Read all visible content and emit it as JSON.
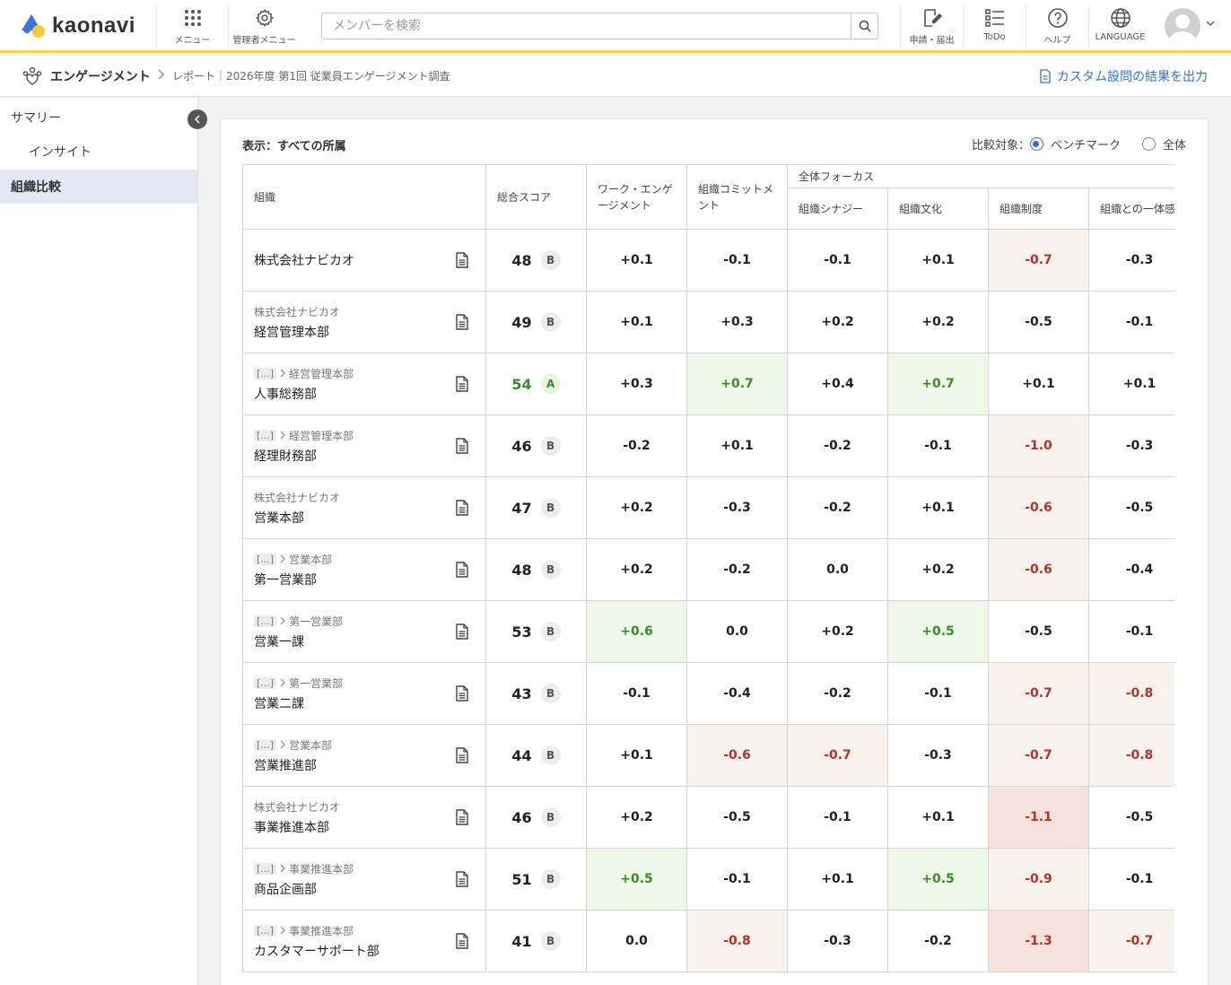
{
  "brand": {
    "logo_text": "kaonavi"
  },
  "topnav": {
    "menu_label": "メニュー",
    "admin_label": "管理者メニュー",
    "request_label": "申請・届出",
    "todo_label": "ToDo",
    "help_label": "ヘルプ",
    "language_label": "LANGUAGE"
  },
  "search": {
    "placeholder": "メンバーを検索"
  },
  "subheader": {
    "title": "エンゲージメント",
    "path": "レポート｜2026年度 第1回 従業員エンゲージメント調査",
    "export_label": "カスタム設問の結果を出力"
  },
  "sidebar": {
    "items": [
      {
        "label": "サマリー"
      },
      {
        "label": "インサイト"
      },
      {
        "label": "組織比較"
      }
    ]
  },
  "panel": {
    "display_label": "表示：すべての所属",
    "compare_label": "比較対象：",
    "compare_options": [
      "ベンチマーク",
      "全体"
    ],
    "compare_selected": "ベンチマーク"
  },
  "table": {
    "headers": {
      "org": "組織",
      "total": "総合スコア",
      "work": "ワーク・エンゲージメント",
      "commit": "組織コミットメント",
      "focus_group": "全体フォーカス",
      "focus": [
        "組織シナジー",
        "組織文化",
        "組織制度",
        "組織との一体感"
      ]
    },
    "rows": [
      {
        "parent": "",
        "name": "株式会社ナビカオ",
        "score": 48,
        "grade": "B",
        "values": [
          "+0.1",
          "-0.1",
          "-0.1",
          "+0.1",
          "-0.7",
          "-0.3"
        ],
        "tones": [
          "",
          "",
          "",
          "",
          "neg1",
          ""
        ]
      },
      {
        "parent": "株式会社ナビカオ",
        "name": "経営管理本部",
        "score": 49,
        "grade": "B",
        "values": [
          "+0.1",
          "+0.3",
          "+0.2",
          "+0.2",
          "-0.5",
          "-0.1"
        ],
        "tones": [
          "",
          "",
          "",
          "",
          "",
          ""
        ]
      },
      {
        "parent": "経営管理本部",
        "ellipsis": "[...]",
        "name": "人事総務部",
        "score": 54,
        "grade": "A",
        "values": [
          "+0.3",
          "+0.7",
          "+0.4",
          "+0.7",
          "+0.1",
          "+0.1"
        ],
        "tones": [
          "",
          "pos",
          "",
          "pos",
          "",
          ""
        ]
      },
      {
        "parent": "経営管理本部",
        "ellipsis": "[...]",
        "name": "経理財務部",
        "score": 46,
        "grade": "B",
        "values": [
          "-0.2",
          "+0.1",
          "-0.2",
          "-0.1",
          "-1.0",
          "-0.3"
        ],
        "tones": [
          "",
          "",
          "",
          "",
          "neg1",
          ""
        ]
      },
      {
        "parent": "株式会社ナビカオ",
        "name": "営業本部",
        "score": 47,
        "grade": "B",
        "values": [
          "+0.2",
          "-0.3",
          "-0.2",
          "+0.1",
          "-0.6",
          "-0.5"
        ],
        "tones": [
          "",
          "",
          "",
          "",
          "neg1",
          ""
        ]
      },
      {
        "parent": "営業本部",
        "ellipsis": "[...]",
        "name": "第一営業部",
        "score": 48,
        "grade": "B",
        "values": [
          "+0.2",
          "-0.2",
          "0.0",
          "+0.2",
          "-0.6",
          "-0.4"
        ],
        "tones": [
          "",
          "",
          "",
          "",
          "neg1",
          ""
        ]
      },
      {
        "parent": "第一営業部",
        "ellipsis": "[...]",
        "name": "営業一課",
        "score": 53,
        "grade": "B",
        "values": [
          "+0.6",
          "0.0",
          "+0.2",
          "+0.5",
          "-0.5",
          "-0.1"
        ],
        "tones": [
          "pos",
          "",
          "",
          "pos",
          "",
          ""
        ]
      },
      {
        "parent": "第一営業部",
        "ellipsis": "[...]",
        "name": "営業二課",
        "score": 43,
        "grade": "B",
        "values": [
          "-0.1",
          "-0.4",
          "-0.2",
          "-0.1",
          "-0.7",
          "-0.8"
        ],
        "tones": [
          "",
          "",
          "",
          "",
          "neg1",
          "neg1"
        ]
      },
      {
        "parent": "営業本部",
        "ellipsis": "[...]",
        "name": "営業推進部",
        "score": 44,
        "grade": "B",
        "values": [
          "+0.1",
          "-0.6",
          "-0.7",
          "-0.3",
          "-0.7",
          "-0.8"
        ],
        "tones": [
          "",
          "neg1",
          "neg1",
          "",
          "neg1",
          "neg1"
        ]
      },
      {
        "parent": "株式会社ナビカオ",
        "name": "事業推進本部",
        "score": 46,
        "grade": "B",
        "values": [
          "+0.2",
          "-0.5",
          "-0.1",
          "+0.1",
          "-1.1",
          "-0.5"
        ],
        "tones": [
          "",
          "",
          "",
          "",
          "neg2",
          ""
        ]
      },
      {
        "parent": "事業推進本部",
        "ellipsis": "[...]",
        "name": "商品企画部",
        "score": 51,
        "grade": "B",
        "values": [
          "+0.5",
          "-0.1",
          "+0.1",
          "+0.5",
          "-0.9",
          "-0.1"
        ],
        "tones": [
          "pos",
          "",
          "",
          "pos",
          "neg1",
          ""
        ]
      },
      {
        "parent": "事業推進本部",
        "ellipsis": "[...]",
        "name": "カスタマーサポート部",
        "score": 41,
        "grade": "B",
        "values": [
          "0.0",
          "-0.8",
          "-0.3",
          "-0.2",
          "-1.3",
          "-0.7"
        ],
        "tones": [
          "",
          "neg1",
          "",
          "",
          "neg2",
          "neg1"
        ]
      }
    ]
  }
}
